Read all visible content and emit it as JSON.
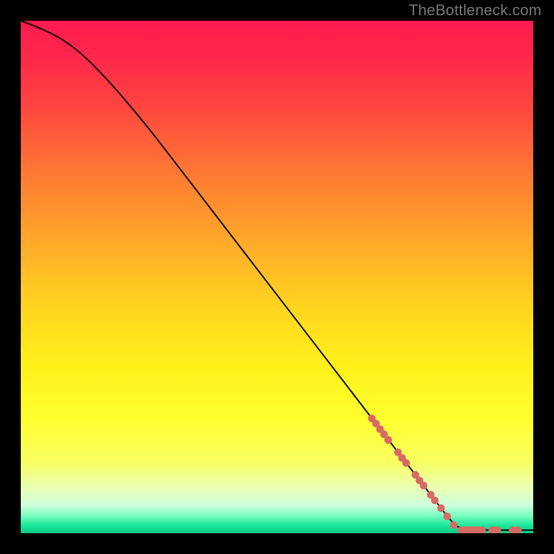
{
  "attribution": "TheBottleneck.com",
  "chart_data": {
    "type": "line",
    "title": "",
    "xlabel": "",
    "ylabel": "",
    "xlim": [
      0,
      100
    ],
    "ylim": [
      0,
      100
    ],
    "grid": false,
    "legend": false,
    "curve": [
      {
        "x": 0,
        "y": 100
      },
      {
        "x": 4,
        "y": 98.5
      },
      {
        "x": 8,
        "y": 96.5
      },
      {
        "x": 12,
        "y": 93.5
      },
      {
        "x": 16,
        "y": 89.5
      },
      {
        "x": 20,
        "y": 85
      },
      {
        "x": 25,
        "y": 79
      },
      {
        "x": 30,
        "y": 72.5
      },
      {
        "x": 35,
        "y": 66
      },
      {
        "x": 40,
        "y": 59.5
      },
      {
        "x": 45,
        "y": 53
      },
      {
        "x": 50,
        "y": 46.5
      },
      {
        "x": 55,
        "y": 40
      },
      {
        "x": 60,
        "y": 33.5
      },
      {
        "x": 65,
        "y": 27
      },
      {
        "x": 70,
        "y": 20.5
      },
      {
        "x": 75,
        "y": 14
      },
      {
        "x": 80,
        "y": 7.5
      },
      {
        "x": 84,
        "y": 2.3
      },
      {
        "x": 86,
        "y": 0.6
      },
      {
        "x": 100,
        "y": 0.6
      }
    ],
    "markers": [
      {
        "x": 68.5,
        "y": 22.4
      },
      {
        "x": 69.3,
        "y": 21.4
      },
      {
        "x": 70.1,
        "y": 20.3
      },
      {
        "x": 70.9,
        "y": 19.3
      },
      {
        "x": 71.7,
        "y": 18.2
      },
      {
        "x": 73.6,
        "y": 15.8
      },
      {
        "x": 74.4,
        "y": 14.7
      },
      {
        "x": 75.2,
        "y": 13.7
      },
      {
        "x": 77.0,
        "y": 11.4
      },
      {
        "x": 77.8,
        "y": 10.3
      },
      {
        "x": 78.6,
        "y": 9.3
      },
      {
        "x": 80.0,
        "y": 7.5
      },
      {
        "x": 80.8,
        "y": 6.4
      },
      {
        "x": 82.0,
        "y": 4.9
      },
      {
        "x": 83.2,
        "y": 3.3
      },
      {
        "x": 84.5,
        "y": 1.6
      },
      {
        "x": 86.0,
        "y": 0.6
      },
      {
        "x": 86.8,
        "y": 0.6
      },
      {
        "x": 87.6,
        "y": 0.6
      },
      {
        "x": 88.4,
        "y": 0.6
      },
      {
        "x": 89.2,
        "y": 0.6
      },
      {
        "x": 90.0,
        "y": 0.6
      },
      {
        "x": 92.0,
        "y": 0.6
      },
      {
        "x": 93.0,
        "y": 0.6
      },
      {
        "x": 96.0,
        "y": 0.6
      },
      {
        "x": 97.0,
        "y": 0.6
      }
    ],
    "gradient_stops": [
      {
        "offset": 0,
        "color": "#ff1a4f"
      },
      {
        "offset": 0.08,
        "color": "#ff2a49"
      },
      {
        "offset": 0.18,
        "color": "#ff4a3e"
      },
      {
        "offset": 0.3,
        "color": "#ff7a33"
      },
      {
        "offset": 0.42,
        "color": "#ffa52a"
      },
      {
        "offset": 0.55,
        "color": "#ffd21f"
      },
      {
        "offset": 0.68,
        "color": "#fff21a"
      },
      {
        "offset": 0.78,
        "color": "#ffff30"
      },
      {
        "offset": 0.86,
        "color": "#f8ff60"
      },
      {
        "offset": 0.91,
        "color": "#eaffb0"
      },
      {
        "offset": 0.945,
        "color": "#cfffde"
      },
      {
        "offset": 0.965,
        "color": "#7dffc0"
      },
      {
        "offset": 0.985,
        "color": "#18e89a"
      },
      {
        "offset": 1.0,
        "color": "#0dc983"
      }
    ],
    "marker_color": "#d86a66",
    "curve_color": "#000000"
  }
}
